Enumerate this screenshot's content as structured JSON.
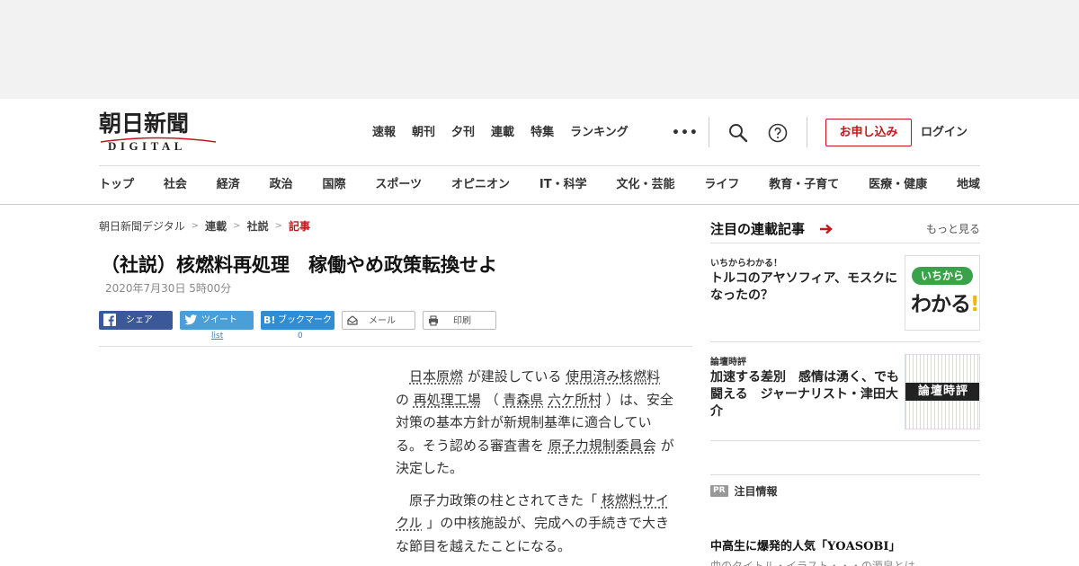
{
  "brand": {
    "logo_kanji": "朝日新聞",
    "logo_sub": "DIGITAL",
    "accent": "#c4161c"
  },
  "topnav": [
    "速報",
    "朝刊",
    "夕刊",
    "連載",
    "特集",
    "ランキング"
  ],
  "header": {
    "more": "•••",
    "apply": "お申し込み",
    "login": "ログイン"
  },
  "catnav": [
    "トップ",
    "社会",
    "経済",
    "政治",
    "国際",
    "スポーツ",
    "オピニオン",
    "IT・科学",
    "文化・芸能",
    "ライフ",
    "教育・子育て",
    "医療・健康",
    "地域"
  ],
  "breadcrumb": [
    "朝日新聞デジタル",
    "連載",
    "社説",
    "記事"
  ],
  "breadcrumb_sep": ">",
  "article": {
    "title": "（社説）核燃料再処理　稼働やめ政策転換せよ",
    "date": "2020年7月30日 5時00分",
    "p1": {
      "a": "日本原燃",
      "b": " が建設している ",
      "c": "使用済み核燃料",
      "d": " の ",
      "e": "再処理工場",
      "f": " （ ",
      "g": "青森県",
      "h": " ",
      "i": "六ケ所村",
      "j": " ）は、安全対策の基本方針が新規制基準に適合している。そう認める審査書を ",
      "k": "原子力規制委員会",
      "l": " が決定した。"
    },
    "p2": {
      "a": "原子力政策の柱とされてきた「 ",
      "b": "核燃料サイクル",
      "c": " 」の中核施設が、完成への手続きで大きな節目を越えたことになる。"
    }
  },
  "share": {
    "facebook": "シェア",
    "twitter": "ツイート",
    "twitter_count": "list",
    "hatena": "ブックマーク",
    "hatena_count": "0",
    "mail": "メール",
    "print": "印刷"
  },
  "sidebar": {
    "heading": "注目の連載記事",
    "more": "もっと見る",
    "items": [
      {
        "category": "いちからわかる！",
        "title": "トルコのアヤソフィア、モスクになったの？",
        "thumb_top": "いちから",
        "thumb_bottom": "わかる"
      },
      {
        "category": "論壇時評",
        "title": "加速する差別　感情は湧く、でも闘える　ジャーナリスト・津田大介",
        "thumb_text": "論壇時評"
      }
    ]
  },
  "promo": {
    "badge": "PR",
    "label": "注目情報",
    "headline": "中高生に爆発的人気「YOASOBI」",
    "sub": "曲のタイトル・イラスト・・・の源泉とは"
  }
}
